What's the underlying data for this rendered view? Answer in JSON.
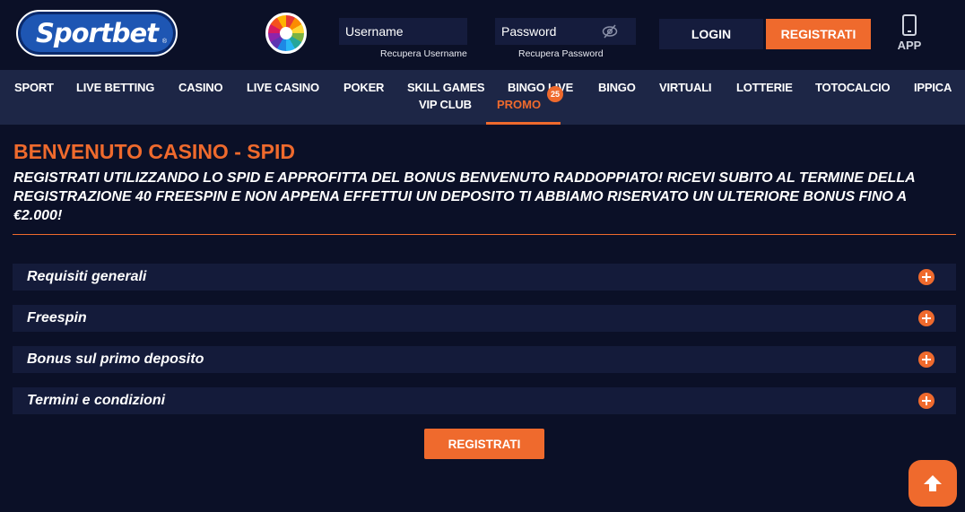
{
  "header": {
    "logo_text": "Sportbet",
    "logo_reg": "®",
    "username_placeholder": "Username",
    "password_placeholder": "Password",
    "recover_username": "Recupera Username",
    "recover_password": "Recupera Password",
    "login_label": "LOGIN",
    "register_label": "REGISTRATI",
    "app_label": "APP",
    "icons": [
      "wheel-icon",
      "eye-slash-icon",
      "phone-icon"
    ]
  },
  "nav": {
    "items": [
      {
        "label": "SPORT"
      },
      {
        "label": "LIVE BETTING"
      },
      {
        "label": "CASINO"
      },
      {
        "label": "LIVE CASINO"
      },
      {
        "label": "POKER"
      },
      {
        "label": "SKILL GAMES"
      },
      {
        "label": "BINGO LIVE"
      },
      {
        "label": "BINGO"
      },
      {
        "label": "VIRTUALI"
      },
      {
        "label": "LOTTERIE"
      },
      {
        "label": "TOTOCALCIO"
      },
      {
        "label": "IPPICA"
      }
    ],
    "row2": [
      {
        "label": "VIP CLUB"
      },
      {
        "label": "PROMO",
        "badge": "25",
        "active": true
      }
    ]
  },
  "content": {
    "title": "BENVENUTO CASINO - SPID",
    "subtitle": "REGISTRATI UTILIZZANDO LO SPID E APPROFITTA DEL BONUS BENVENUTO RADDOPPIATO! RICEVI SUBITO AL TERMINE DELLA REGISTRAZIONE 40 FREESPIN E NON APPENA EFFETTUI UN DEPOSITO TI ABBIAMO RISERVATO UN ULTERIORE BONUS FINO A €2.000!",
    "accordion": [
      {
        "label": "Requisiti generali"
      },
      {
        "label": "Freespin"
      },
      {
        "label": "Bonus sul primo deposito"
      },
      {
        "label": "Termini e condizioni"
      }
    ],
    "register_button": "REGISTRATI"
  },
  "colors": {
    "background": "#0b1027",
    "nav": "#1d2646",
    "accent": "#ef6a2d",
    "panel": "#141b3a"
  }
}
